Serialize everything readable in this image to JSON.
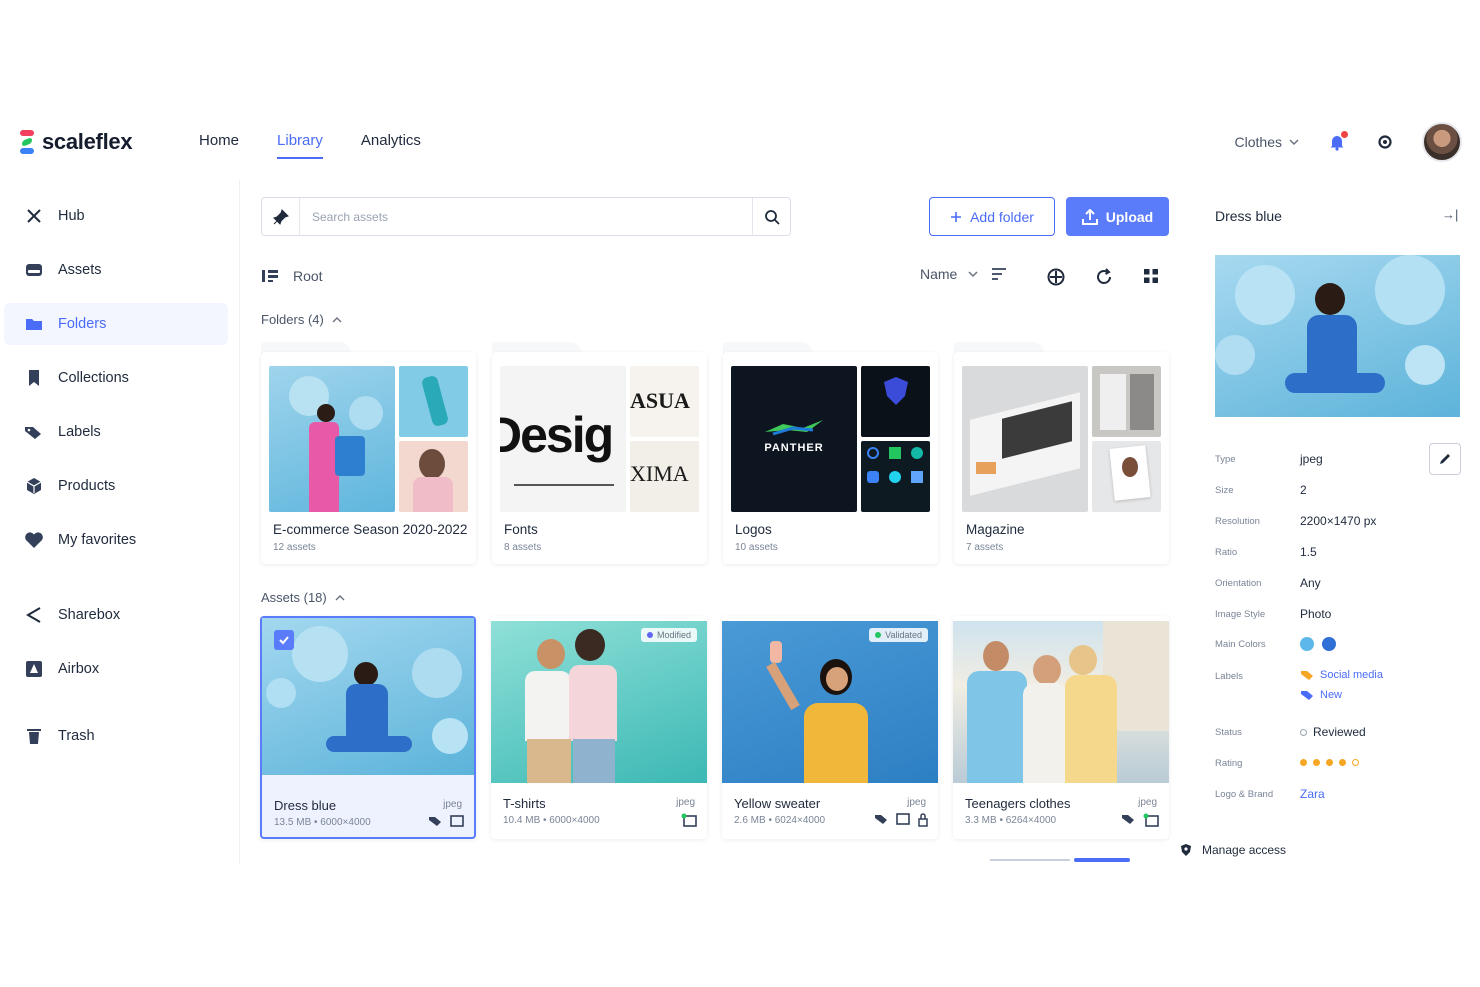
{
  "brand": {
    "name": "scaleflex"
  },
  "topnav": {
    "items": [
      "Home",
      "Library",
      "Analytics"
    ],
    "active": "Library"
  },
  "project": {
    "label": "Clothes"
  },
  "sidebar": {
    "items": [
      {
        "label": "Hub",
        "icon": "close-x-icon"
      },
      {
        "label": "Assets",
        "icon": "assets-icon"
      },
      {
        "label": "Folders",
        "icon": "folder-icon",
        "active": true
      },
      {
        "label": "Collections",
        "icon": "bookmark-icon"
      },
      {
        "label": "Labels",
        "icon": "tag-icon"
      },
      {
        "label": "Products",
        "icon": "product-icon"
      },
      {
        "label": "My favorites",
        "icon": "heart-icon"
      },
      {
        "label": "Sharebox",
        "icon": "share-icon"
      },
      {
        "label": "Airbox",
        "icon": "airbox-icon"
      },
      {
        "label": "Trash",
        "icon": "trash-icon"
      }
    ]
  },
  "search": {
    "placeholder": "Search assets",
    "value": ""
  },
  "toolbar": {
    "add_folder": "Add folder",
    "upload": "Upload"
  },
  "breadcrumb": {
    "root": "Root"
  },
  "sort": {
    "label": "Name"
  },
  "folders_section": {
    "label": "Folders (4)"
  },
  "folders": [
    {
      "name": "E-commerce Season 2020-2022",
      "count": "12 assets"
    },
    {
      "name": "Fonts",
      "count": "8 assets"
    },
    {
      "name": "Logos",
      "count": "10 assets"
    },
    {
      "name": "Magazine",
      "count": "7 assets"
    }
  ],
  "assets_section": {
    "label": "Assets (18)"
  },
  "assets": [
    {
      "name": "Dress blue",
      "type": "jpeg",
      "meta": "13.5 MB • 6000×4000",
      "selected": true,
      "badge": ""
    },
    {
      "name": "T-shirts",
      "type": "jpeg",
      "meta": "10.4 MB • 6000×4000",
      "selected": false,
      "badge": "Modified"
    },
    {
      "name": "Yellow sweater",
      "type": "jpeg",
      "meta": "2.6 MB • 6024×4000",
      "selected": false,
      "badge": "Validated"
    },
    {
      "name": "Teenagers clothes",
      "type": "jpeg",
      "meta": "3.3 MB • 6264×4000",
      "selected": false,
      "badge": ""
    }
  ],
  "panel": {
    "title": "Dress blue",
    "rows": [
      {
        "key": "Type",
        "value": "jpeg"
      },
      {
        "key": "Size",
        "value": "2"
      },
      {
        "key": "Resolution",
        "value": "2200×1470 px"
      },
      {
        "key": "Ratio",
        "value": "1.5"
      },
      {
        "key": "Orientation",
        "value": "Any"
      },
      {
        "key": "Image Style",
        "value": "Photo"
      },
      {
        "key": "Main Colors",
        "value": ""
      },
      {
        "key": "Labels",
        "value": ""
      },
      {
        "key": "Status",
        "value": "Reviewed"
      },
      {
        "key": "Rating",
        "value": ""
      },
      {
        "key": "Logo & Brand",
        "value": "Zara"
      }
    ],
    "main_colors": [
      "#5bb8e8",
      "#2f6fd6"
    ],
    "labels": [
      {
        "text": "Social media",
        "color": "#f5a623"
      },
      {
        "text": "New",
        "color": "#4a6cf7"
      }
    ],
    "rating": 4,
    "rating_max": 5,
    "manage_access": "Manage access"
  },
  "colors": {
    "accent": "#4a6cf7",
    "primary_button": "#5b7cfa",
    "star": "#f5a623"
  }
}
